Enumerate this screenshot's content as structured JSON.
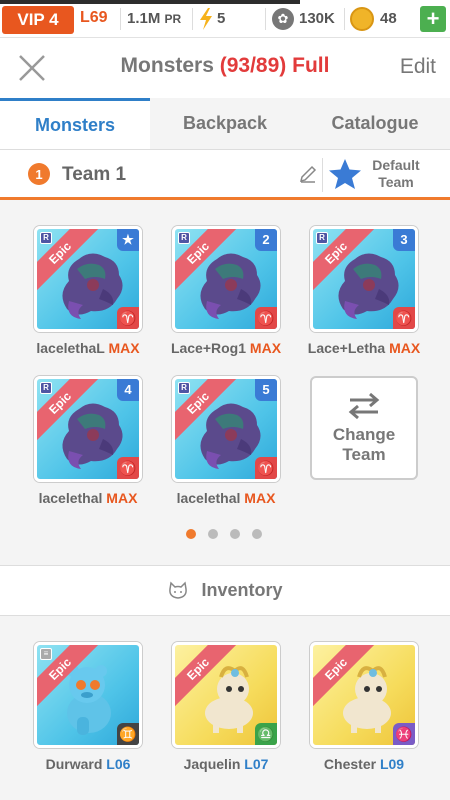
{
  "status": {
    "vip": "VIP 4",
    "level": "L69",
    "power": "1.1M",
    "power_unit": "PR",
    "energy": "5",
    "paws": "130K",
    "coins": "48"
  },
  "header": {
    "title": "Monsters",
    "count": "(93/89) Full",
    "edit": "Edit"
  },
  "tabs": [
    {
      "label": "Monsters"
    },
    {
      "label": "Backpack"
    },
    {
      "label": "Catalogue"
    }
  ],
  "team": {
    "number": "1",
    "name": "Team 1",
    "default_label_1": "Default",
    "default_label_2": "Team"
  },
  "team_monsters": [
    {
      "rarity": "Epic",
      "slot": "★",
      "zodiac": "♈",
      "name": "lacelethaL",
      "max": "MAX"
    },
    {
      "rarity": "Epic",
      "slot": "2",
      "zodiac": "♈",
      "name": "Lace+Rog1",
      "max": "MAX"
    },
    {
      "rarity": "Epic",
      "slot": "3",
      "zodiac": "♈",
      "name": "Lace+Letha",
      "max": "MAX"
    },
    {
      "rarity": "Epic",
      "slot": "4",
      "zodiac": "♈",
      "name": "lacelethal",
      "max": "MAX"
    },
    {
      "rarity": "Epic",
      "slot": "5",
      "zodiac": "♈",
      "name": "lacelethal",
      "max": "MAX"
    }
  ],
  "change_team": {
    "label": "Change Team"
  },
  "pager": {
    "pages": 4,
    "active": 0
  },
  "inventory": {
    "label": "Inventory",
    "items": [
      {
        "rarity": "Epic",
        "zodiac": "♊",
        "name": "Durward",
        "level": "L06"
      },
      {
        "rarity": "Epic",
        "zodiac": "♎",
        "name": "Jaquelin",
        "level": "L07"
      },
      {
        "rarity": "Epic",
        "zodiac": "♓",
        "name": "Chester",
        "level": "L09"
      }
    ]
  },
  "colors": {
    "accent_orange": "#f07a2d",
    "tab_blue": "#2f7fc8",
    "full_red": "#e23b3b",
    "card_ribbon": "#e8646f"
  }
}
